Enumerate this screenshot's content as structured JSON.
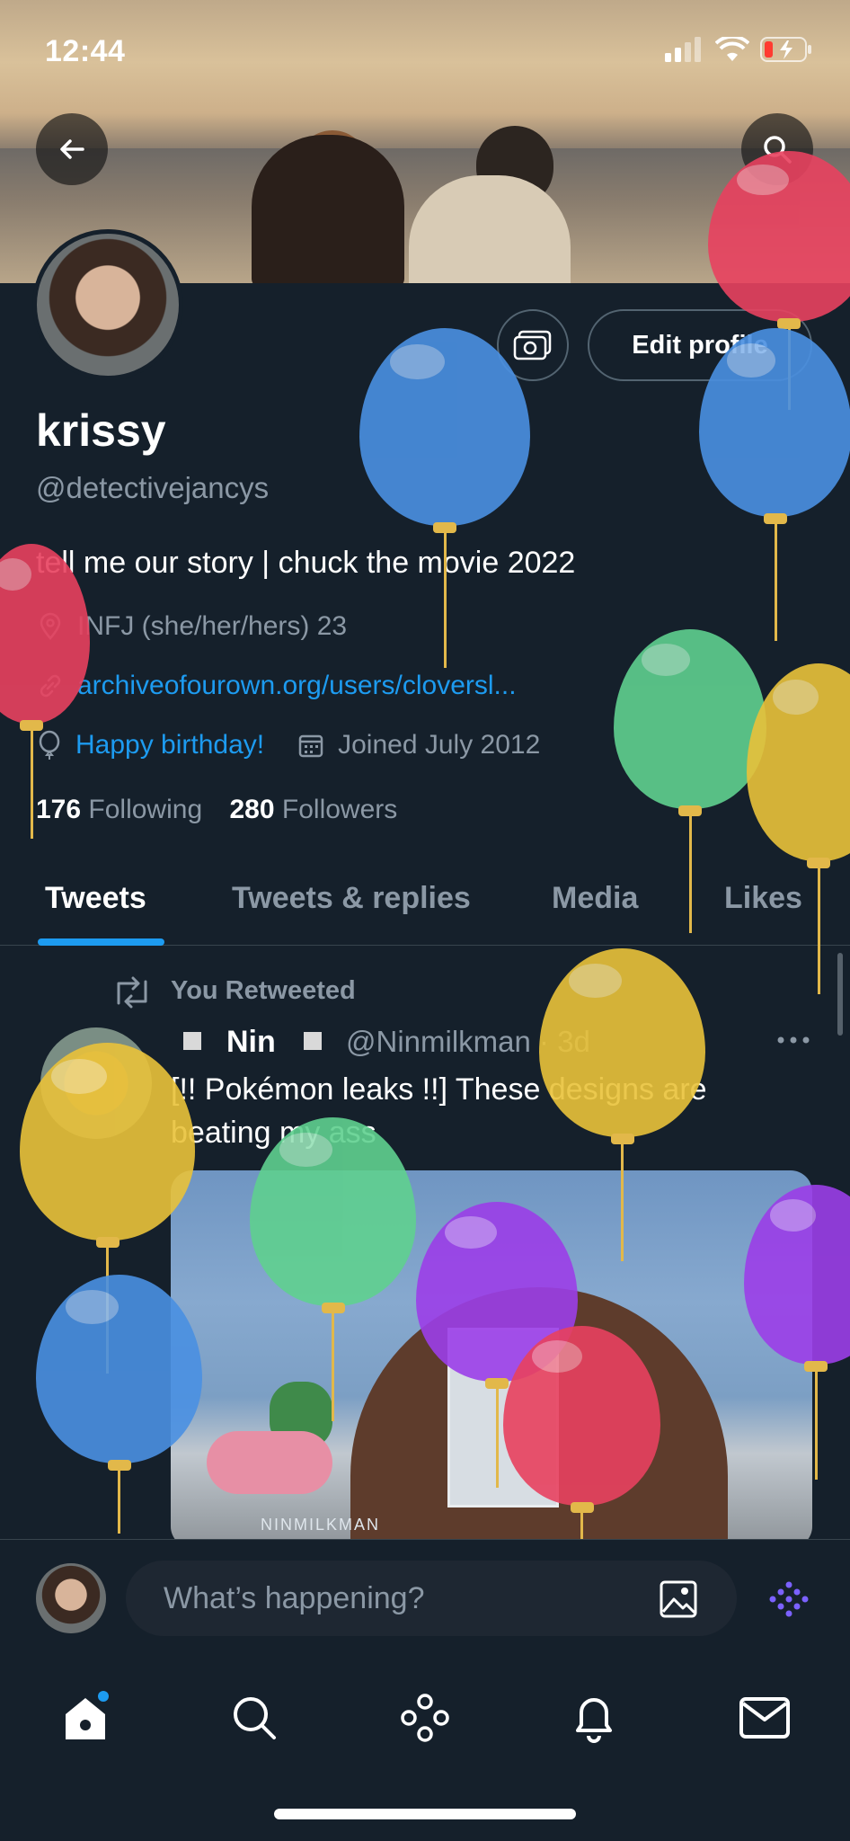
{
  "status_bar": {
    "time": "12:44"
  },
  "profile": {
    "name": "krissy",
    "handle": "@detectivejancys",
    "bio": "tell me our story | chuck the movie 2022",
    "location": "INFJ (she/her/hers) 23",
    "website": "archiveofourown.org/users/cloversl...",
    "birthday": "Happy birthday!",
    "joined": "Joined July 2012",
    "following_count": "176",
    "following_label": "Following",
    "followers_count": "280",
    "followers_label": "Followers",
    "edit_label": "Edit profile"
  },
  "tabs": [
    {
      "label": "Tweets"
    },
    {
      "label": "Tweets & replies"
    },
    {
      "label": "Media"
    },
    {
      "label": "Likes"
    }
  ],
  "tweet": {
    "retweet_label": "You Retweeted",
    "author_name": "Nin",
    "author_handle": "@Ninmilkman · 3d",
    "text": "[!! Pokémon leaks !!] These designs are beating my ass",
    "media_watermark": "NINMILKMAN"
  },
  "compose": {
    "placeholder": "What’s happening?"
  },
  "colors": {
    "background": "#15202b",
    "accent": "#1d9bf0",
    "muted": "#8b98a5"
  },
  "icons": [
    "back-arrow-icon",
    "search-icon",
    "camera-icon",
    "location-icon",
    "link-icon",
    "balloon-icon",
    "calendar-icon",
    "retweet-icon",
    "more-icon",
    "image-icon",
    "sparkle-icon",
    "home-icon",
    "explore-icon",
    "spaces-icon",
    "notifications-icon",
    "messages-icon"
  ]
}
